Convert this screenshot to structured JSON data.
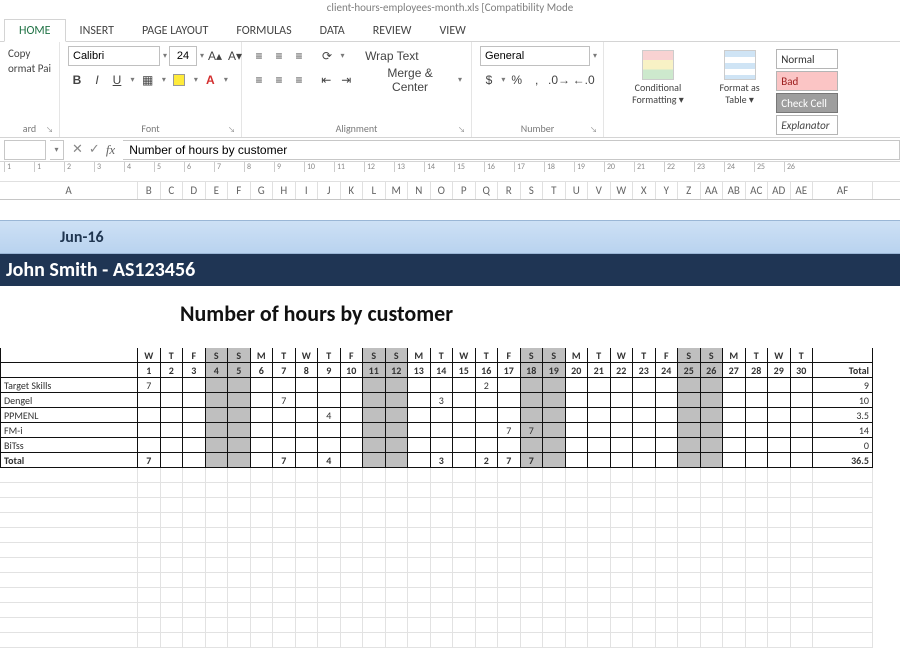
{
  "titlebar": "client-hours-employees-month.xls  [Compatibility Mode",
  "tabs": [
    "HOME",
    "INSERT",
    "PAGE LAYOUT",
    "FORMULAS",
    "DATA",
    "REVIEW",
    "VIEW"
  ],
  "active_tab": 0,
  "clipboard": {
    "copy": "Copy",
    "paint": "ormat Painter",
    "group": "ard"
  },
  "font": {
    "name": "Calibri",
    "size": "24",
    "buttons": {
      "B": "B",
      "I": "I",
      "U": "U"
    },
    "group": "Font"
  },
  "alignment": {
    "wrap": "Wrap Text",
    "merge": "Merge & Center",
    "group": "Alignment"
  },
  "number": {
    "format": "General",
    "group": "Number"
  },
  "styles": {
    "cond": "Conditional Formatting ▾",
    "table": "Format as Table ▾",
    "cells": [
      {
        "name": "Normal",
        "cls": "style-normal"
      },
      {
        "name": "Bad",
        "cls": "style-bad"
      },
      {
        "name": "Check Cell",
        "cls": "style-check"
      },
      {
        "name": "Explanator",
        "cls": "style-explan"
      }
    ]
  },
  "formula": {
    "fx": "fx",
    "value": "Number of hours by customer"
  },
  "ruler_ticks": [
    1,
    1,
    2,
    3,
    4,
    5,
    6,
    7,
    8,
    9,
    10,
    11,
    12,
    13,
    14,
    15,
    16,
    17,
    18,
    19,
    20,
    21,
    22,
    23,
    24,
    25,
    26
  ],
  "columns": [
    "A",
    "B",
    "C",
    "D",
    "E",
    "F",
    "G",
    "H",
    "I",
    "J",
    "K",
    "L",
    "M",
    "N",
    "O",
    "P",
    "Q",
    "R",
    "S",
    "T",
    "U",
    "V",
    "W",
    "X",
    "Y",
    "Z",
    "AA",
    "AB",
    "AC",
    "AD",
    "AE",
    "AF"
  ],
  "month_label": "Jun-16",
  "person_label": "John Smith -  AS123456",
  "report_title": "Number of hours by customer",
  "day_letters": [
    "W",
    "T",
    "F",
    "S",
    "S",
    "M",
    "T",
    "W",
    "T",
    "F",
    "S",
    "S",
    "M",
    "T",
    "W",
    "T",
    "F",
    "S",
    "S",
    "M",
    "T",
    "W",
    "T",
    "F",
    "S",
    "S",
    "M",
    "T",
    "W",
    "T"
  ],
  "day_numbers": [
    1,
    2,
    3,
    4,
    5,
    6,
    7,
    8,
    9,
    10,
    11,
    12,
    13,
    14,
    15,
    16,
    17,
    18,
    19,
    20,
    21,
    22,
    23,
    24,
    25,
    26,
    27,
    28,
    29,
    30
  ],
  "weekend_cols": [
    4,
    5,
    11,
    12,
    18,
    19,
    25,
    26
  ],
  "total_label": "Total",
  "rows": [
    {
      "label": "Target Skills",
      "cls": "lbl-target",
      "cells": {
        "1": 7,
        "16": 2
      },
      "total": 9
    },
    {
      "label": "Dengel",
      "cls": "lbl-dengel",
      "cells": {
        "7": 7,
        "14": 3
      },
      "total": 10
    },
    {
      "label": "PPMENL",
      "cls": "lbl-ppmenl",
      "cells": {
        "9": 4
      },
      "total": 3.5
    },
    {
      "label": "FM-i",
      "cls": "lbl-fmi",
      "cells": {
        "17": 7,
        "18": 7
      },
      "total": 14
    },
    {
      "label": "BiTss",
      "cls": "lbl-bitss",
      "cells": {},
      "total": 0
    }
  ],
  "total_row": {
    "label": "Total",
    "cells": {
      "1": 7,
      "7": 7,
      "9": 4,
      "14": 3,
      "16": 2,
      "17": 7,
      "18": 7
    },
    "total": 36.5
  }
}
